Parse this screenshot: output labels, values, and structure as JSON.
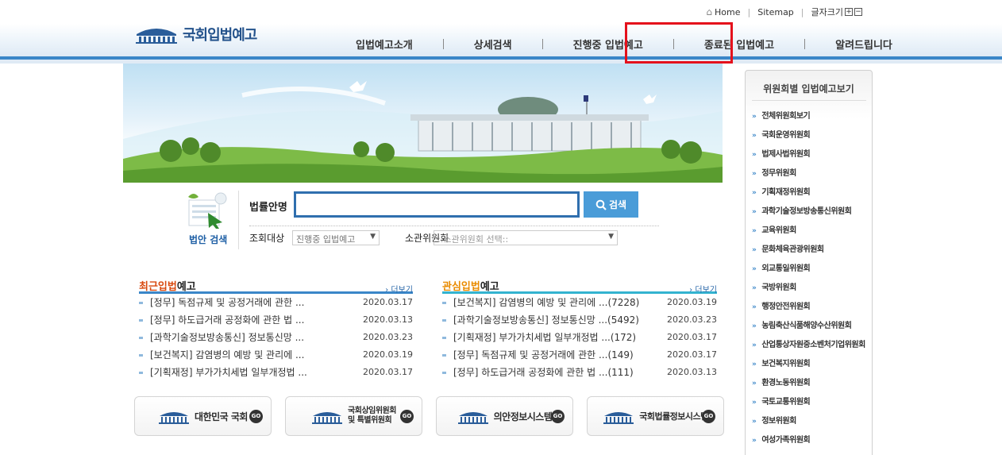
{
  "header": {
    "logo_text": "국회입법예고",
    "util": {
      "home": "Home",
      "sitemap": "Sitemap",
      "font_size": "글자크기",
      "plus": "+",
      "minus": "−"
    },
    "nav": [
      "입법예고소개",
      "상세검색",
      "진행중 입법예고",
      "종료된 입법예고",
      "알려드립니다"
    ]
  },
  "search": {
    "icon_label": "법안 검색",
    "law_name_label": "법률안명",
    "law_name_value": "",
    "button_label": "검색",
    "target_label": "조회대상",
    "target_value": "진행중 입법예고",
    "committee_label": "소관위원회",
    "committee_value": "::소관위원회 선택::"
  },
  "recent": {
    "title_acc": "최근",
    "title_rest1": "입법",
    "title_rest2": "예고",
    "more": "› 더보기",
    "rows": [
      {
        "title": "[정무] 독점규제 및 공정거래에 관한 ...",
        "date": "2020.03.17"
      },
      {
        "title": "[정무] 하도급거래 공정화에 관한 법 ...",
        "date": "2020.03.13"
      },
      {
        "title": "[과학기술정보방송통신] 정보통신망 ...",
        "date": "2020.03.23"
      },
      {
        "title": "[보건복지] 감염병의 예방 및 관리에 ...",
        "date": "2020.03.19"
      },
      {
        "title": "[기획재정] 부가가치세법 일부개정법 ...",
        "date": "2020.03.17"
      }
    ]
  },
  "interest": {
    "title_acc": "관심",
    "title_rest1": "입법",
    "title_rest2": "예고",
    "more": "› 더보기",
    "rows": [
      {
        "title": "[보건복지] 감염병의 예방 및 관리에 ...(7228)",
        "date": "2020.03.19"
      },
      {
        "title": "[과학기술정보방송통신] 정보통신망 ...(5492)",
        "date": "2020.03.23"
      },
      {
        "title": "[기획재정] 부가가치세법 일부개정법 ...(172)",
        "date": "2020.03.17"
      },
      {
        "title": "[정무] 독점규제 및 공정거래에 관한 ...(149)",
        "date": "2020.03.17"
      },
      {
        "title": "[정무] 하도급거래 공정화에 관한 법 ...(111)",
        "date": "2020.03.13"
      }
    ]
  },
  "quick_links": {
    "go": "GO",
    "items": [
      "대한민국 국회",
      "국회상임위원회",
      "및 특별위원회",
      "의안정보시스템",
      "국회법률정보시스템"
    ]
  },
  "sidebar": {
    "title": "위원회별 입법예고보기",
    "items": [
      "전체위원회보기",
      "국회운영위원회",
      "법제사법위원회",
      "정무위원회",
      "기획재정위원회",
      "과학기술정보방송통신위원회",
      "교육위원회",
      "문화체육관광위원회",
      "외교통일위원회",
      "국방위원회",
      "행정안전위원회",
      "농림축산식품해양수산위원회",
      "산업통상자원중소벤처기업위원회",
      "보건복지위원회",
      "환경노동위원회",
      "국토교통위원회",
      "정보위원회",
      "여성가족위원회"
    ]
  },
  "colors": {
    "accent": "#3a86c8",
    "highlight": "#e4111c",
    "search_button": "#4a9cd8"
  }
}
